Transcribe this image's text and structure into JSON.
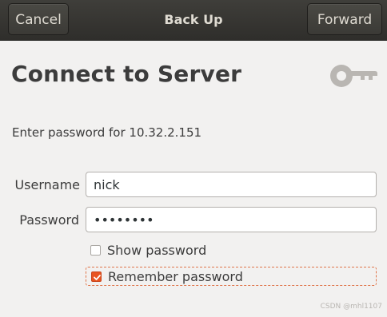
{
  "headerbar": {
    "cancel_label": "Cancel",
    "title": "Back Up",
    "forward_label": "Forward"
  },
  "main": {
    "title": "Connect to Server",
    "prompt": "Enter password for 10.32.2.151",
    "key_icon": "key-icon"
  },
  "form": {
    "username_label": "Username",
    "username_value": "nick",
    "password_label": "Password",
    "password_value": "secretpw",
    "show_password_label": "Show password",
    "show_password_checked": false,
    "remember_password_label": "Remember password",
    "remember_password_checked": true
  },
  "watermark": "CSDN @mhl1107",
  "colors": {
    "accent": "#e95420",
    "headerbar": "#3b3a36",
    "background": "#f2f1f0"
  }
}
